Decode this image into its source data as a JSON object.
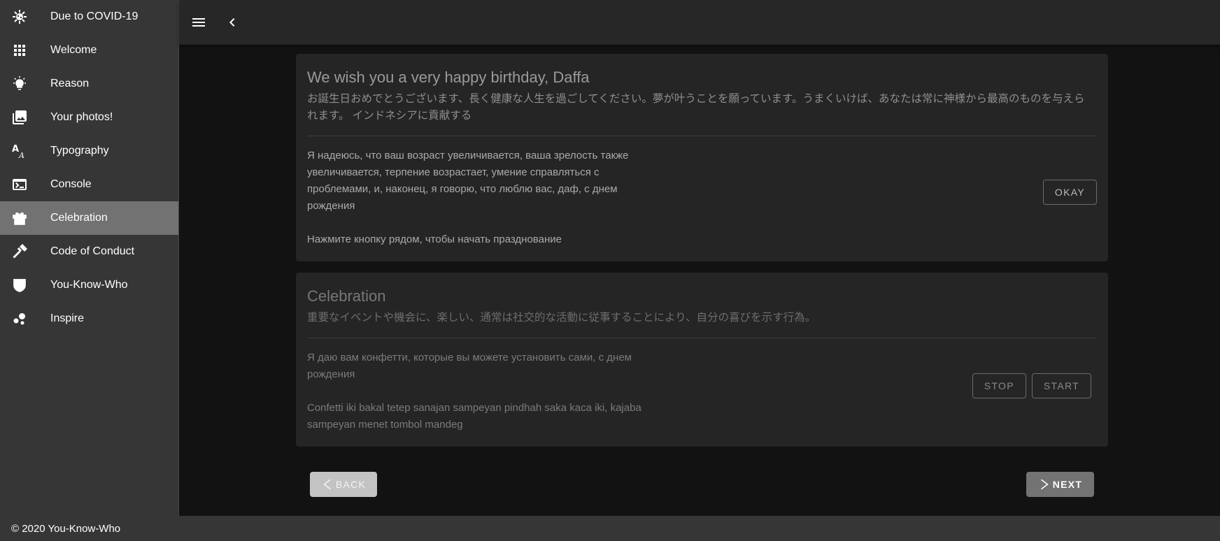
{
  "sidebar": {
    "items": [
      {
        "label": "Due to COVID-19",
        "icon": "virus-icon"
      },
      {
        "label": "Welcome",
        "icon": "apps-grid-icon"
      },
      {
        "label": "Reason",
        "icon": "lightbulb-icon"
      },
      {
        "label": "Your photos!",
        "icon": "photo-library-icon"
      },
      {
        "label": "Typography",
        "icon": "typography-icon"
      },
      {
        "label": "Console",
        "icon": "console-icon"
      },
      {
        "label": "Celebration",
        "icon": "gift-icon",
        "active": true
      },
      {
        "label": "Code of Conduct",
        "icon": "gavel-icon"
      },
      {
        "label": "You-Know-Who",
        "icon": "mask-icon"
      },
      {
        "label": "Inspire",
        "icon": "bubbles-icon"
      }
    ]
  },
  "appbar": {
    "menu_icon": "menu-icon",
    "back_icon": "chevron-left-icon"
  },
  "birthday_card": {
    "title": "We wish you a very happy birthday, Daffa",
    "subtitle": "お誕生日おめでとうございます、長く健康な人生を過ごしてください。夢が叶うことを願っています。うまくいけば、あなたは常に神様から最高のものを与えられます。 インドネシアに貢献する",
    "body_1": "Я надеюсь, что ваш возраст увеличивается, ваша зрелость также увеличивается, терпение возрастает, умение справляться с проблемами, и, наконец, я говорю, что люблю вас, даф, с днем рождения",
    "body_2": "Нажмите кнопку рядом, чтобы начать празднование",
    "okay_label": "OKAY"
  },
  "celebration_card": {
    "title": "Celebration",
    "subtitle": "重要なイベントや機会に、楽しい、通常は社交的な活動に従事することにより、自分の喜びを示す行為。",
    "body_1": "Я даю вам конфетти, которые вы можете установить сами, с днем рождения",
    "body_2": "Confetti iki bakal tetep sanajan sampeyan pindhah saka kaca iki, kajaba sampeyan menet tombol mandeg",
    "stop_label": "STOP",
    "start_label": "START"
  },
  "navigation": {
    "back_label": "BACK",
    "next_label": "NEXT"
  },
  "colors": {
    "sidebar_bg": "#363636",
    "active_item_bg": "#727272",
    "appbar_bg": "#272727",
    "page_bg": "#121212",
    "card_bg": "#252525",
    "back_button_bg": "#c3c3c3",
    "next_button_bg": "#737373"
  },
  "footer": {
    "text": "© 2020 You-Know-Who"
  }
}
